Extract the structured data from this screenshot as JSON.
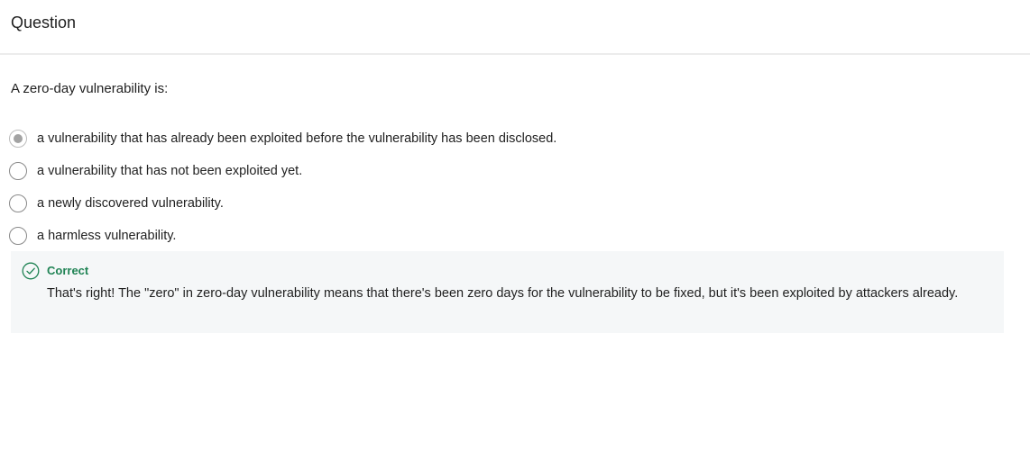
{
  "header": {
    "title": "Question"
  },
  "question": {
    "prompt": "A zero-day vulnerability is:",
    "options": [
      {
        "label": "a vulnerability that has already been exploited before the vulnerability has been disclosed.",
        "selected": true
      },
      {
        "label": "a vulnerability that has not been exploited yet.",
        "selected": false
      },
      {
        "label": "a newly discovered vulnerability.",
        "selected": false
      },
      {
        "label": "a harmless vulnerability.",
        "selected": false
      }
    ]
  },
  "feedback": {
    "status": "Correct",
    "message": "That's right! The \"zero\" in zero-day vulnerability means that there's been zero days for the vulnerability to be fixed, but it's been exploited by attackers already.",
    "icon": "check-circle-icon"
  },
  "colors": {
    "correct_green": "#1f8354",
    "feedback_bg": "#f5f7f8",
    "selected_radio": "#a3a3a3"
  }
}
